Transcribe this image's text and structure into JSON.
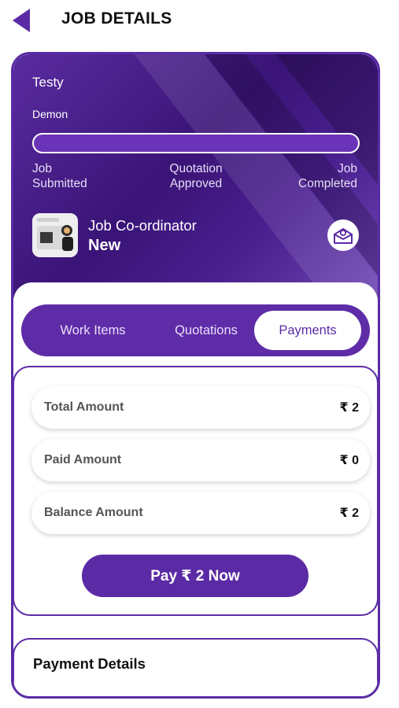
{
  "header": {
    "title": "JOB DETAILS",
    "back_icon": "back-arrow-icon"
  },
  "job": {
    "customer_name": "Testy",
    "customer_subname": "Demon",
    "progress_fraction": 0.0,
    "stages": [
      "Job\nSubmitted",
      "Quotation\nApproved",
      "Job\nCompleted"
    ]
  },
  "coordinator": {
    "role": "Job Co-ordinator",
    "status": "New",
    "mail_icon": "mail-icon"
  },
  "tabs": [
    {
      "label": "Work Items",
      "active": false
    },
    {
      "label": "Quotations",
      "active": false
    },
    {
      "label": "Payments",
      "active": true
    }
  ],
  "payments": {
    "rows": [
      {
        "label": "Total Amount",
        "value": "₹ 2"
      },
      {
        "label": "Paid Amount",
        "value": "₹ 0"
      },
      {
        "label": "Balance Amount",
        "value": "₹ 2"
      }
    ],
    "pay_button": "Pay ₹ 2 Now"
  },
  "payment_details": {
    "title": "Payment Details"
  },
  "colors": {
    "accent": "#5b2ba6",
    "hero_dark": "#3a1477",
    "white": "#ffffff"
  }
}
